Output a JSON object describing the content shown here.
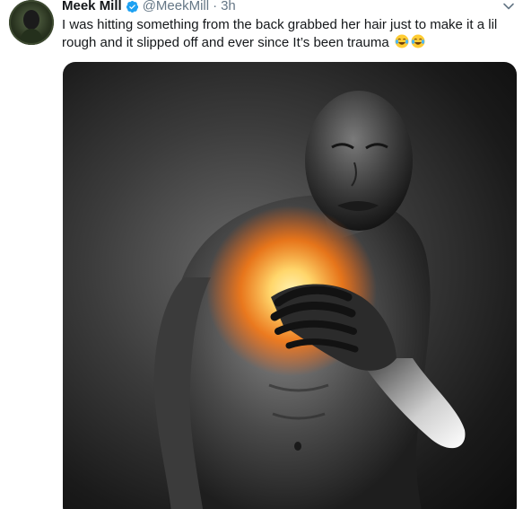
{
  "tweet": {
    "display_name": "Meek Mill",
    "handle": "@MeekMill",
    "separator": "·",
    "time": "3h",
    "text": "I was hitting something from the back grabbed her hair just to make it a lil rough and it slipped off and ever since It’s been trauma",
    "emojis": [
      "face-with-tears-of-joy",
      "face-with-tears-of-joy"
    ]
  },
  "colors": {
    "verified_blue": "#1da1f2",
    "secondary_text": "#657786",
    "primary_text": "#14171a",
    "glow_core": "#ffd66b",
    "glow_outer": "#ff5a00"
  }
}
